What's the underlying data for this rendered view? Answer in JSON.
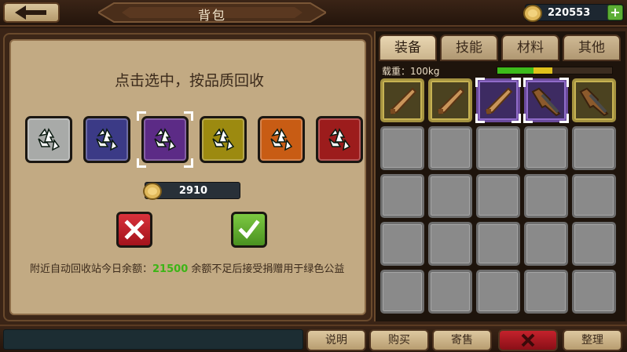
{
  "header": {
    "title": "背包",
    "back_icon": "arrow-left-icon",
    "currency": {
      "icon": "gold-coin-icon",
      "value": "220553",
      "plus_label": "+"
    }
  },
  "recycle": {
    "title": "点击选中，按品质回收",
    "qualities": [
      {
        "name": "gray",
        "color": "#a8aaa8",
        "selected": false
      },
      {
        "name": "blue",
        "color": "#3b3a86",
        "selected": false
      },
      {
        "name": "purple",
        "color": "#5c2b86",
        "selected": true
      },
      {
        "name": "yellow",
        "color": "#9c8a10",
        "selected": false
      },
      {
        "name": "orange",
        "color": "#c85c14",
        "selected": false
      },
      {
        "name": "red",
        "color": "#9c1c1c",
        "selected": false
      }
    ],
    "cost": "2910",
    "cancel_icon": "x-icon",
    "confirm_icon": "check-icon",
    "note_prefix": "附近自动回收站今日余额：",
    "note_amount": "21500",
    "note_suffix": "余额不足后接受捐赠用于绿色公益"
  },
  "inventory": {
    "tabs": [
      {
        "label": "装备",
        "active": true
      },
      {
        "label": "技能",
        "active": false
      },
      {
        "label": "材料",
        "active": false
      },
      {
        "label": "其他",
        "active": false
      }
    ],
    "weight_label": "载重：100kg",
    "weight_fill_fraction": 0.48,
    "items": [
      {
        "icon": "baseball-bat-icon",
        "quality": "gold",
        "selected": false
      },
      {
        "icon": "baseball-bat-icon",
        "quality": "gold",
        "selected": false
      },
      {
        "icon": "baseball-bat-icon",
        "quality": "purple",
        "selected": true
      },
      {
        "icon": "shotgun-icon",
        "quality": "purple",
        "selected": true
      },
      {
        "icon": "shotgun-icon",
        "quality": "gold",
        "selected": false
      }
    ],
    "empty_slots": 20
  },
  "footer": {
    "buttons": [
      "说明",
      "购买",
      "寄售",
      "整理"
    ],
    "close_icon": "x-icon"
  }
}
